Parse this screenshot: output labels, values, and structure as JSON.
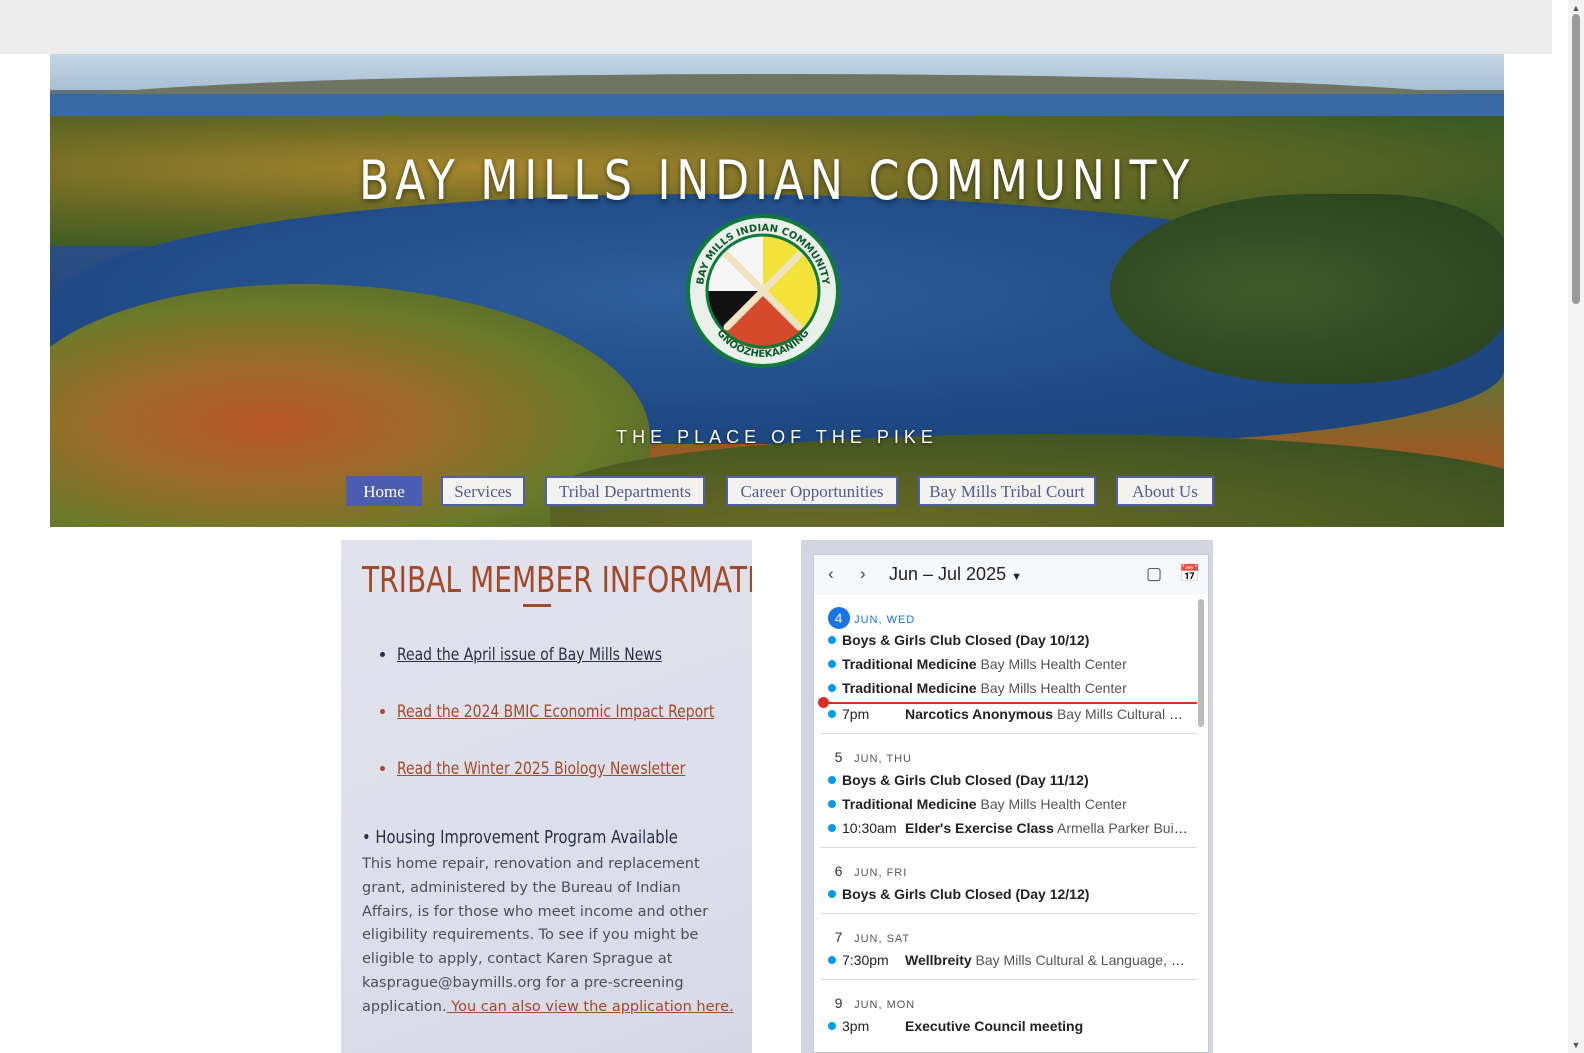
{
  "hero": {
    "title": "BAY MILLS INDIAN COMMUNITY",
    "tagline": "THE PLACE OF THE PIKE",
    "seal": {
      "top_text": "BAY MILLS INDIAN COMMUNITY",
      "bottom_text": "GNOOZHEKAANING"
    }
  },
  "nav": {
    "items": [
      {
        "label": "Home",
        "active": true
      },
      {
        "label": "Services"
      },
      {
        "label": "Tribal Departments"
      },
      {
        "label": "Career Opportunities"
      },
      {
        "label": "Bay Mills Tribal Court"
      },
      {
        "label": "About Us"
      }
    ]
  },
  "info": {
    "title": "TRIBAL MEMBER INFORMATION",
    "links": [
      "Read the April issue of Bay Mills News",
      "Read the 2024 BMIC Economic Impact Report",
      "Read the Winter 2025 Biology Newsletter"
    ],
    "housing_heading": "• Housing Improvement Program Available",
    "housing_body": "This home repair, renovation and replacement grant, administered by the Bureau of Indian Affairs, is for those who meet income and other eligibility requirements. To see if you might be eligible to apply, contact Karen Sprague at kasprague@baymills.org for a pre-screening application.",
    "housing_link": " You can also view the application here."
  },
  "calendar": {
    "range": "Jun – Jul 2025",
    "days": [
      {
        "num": "4",
        "label": "JUN, WED",
        "today": true,
        "events": [
          {
            "time": "",
            "title": "Boys & Girls Club Closed (Day 10/12)",
            "location": ""
          },
          {
            "time": "",
            "title": "Traditional Medicine",
            "location": "Bay Mills Health Center"
          },
          {
            "time": "",
            "title": "Traditional Medicine",
            "location": "Bay Mills Health Center"
          },
          {
            "time": "7pm",
            "title": "Narcotics Anonymous",
            "location": "Bay Mills Cultural &..."
          }
        ]
      },
      {
        "num": "5",
        "label": "JUN, THU",
        "events": [
          {
            "time": "",
            "title": "Boys & Girls Club Closed (Day 11/12)",
            "location": ""
          },
          {
            "time": "",
            "title": "Traditional Medicine",
            "location": "Bay Mills Health Center"
          },
          {
            "time": "10:30am",
            "title": "Elder's Exercise Class",
            "location": "Armella Parker Buil..."
          }
        ]
      },
      {
        "num": "6",
        "label": "JUN, FRI",
        "events": [
          {
            "time": "",
            "title": "Boys & Girls Club Closed (Day 12/12)",
            "location": ""
          }
        ]
      },
      {
        "num": "7",
        "label": "JUN, SAT",
        "events": [
          {
            "time": "7:30pm",
            "title": "Wellbreity",
            "location": "Bay Mills Cultural & Language, 1..."
          }
        ]
      },
      {
        "num": "9",
        "label": "JUN, MON",
        "events": [
          {
            "time": "3pm",
            "title": "Executive Council meeting",
            "location": ""
          }
        ]
      }
    ]
  },
  "colors": {
    "accent_rust": "#a14a2a",
    "nav_active": "#4c5cb0",
    "today_blue": "#1a73e8",
    "now_red": "#d93025"
  }
}
